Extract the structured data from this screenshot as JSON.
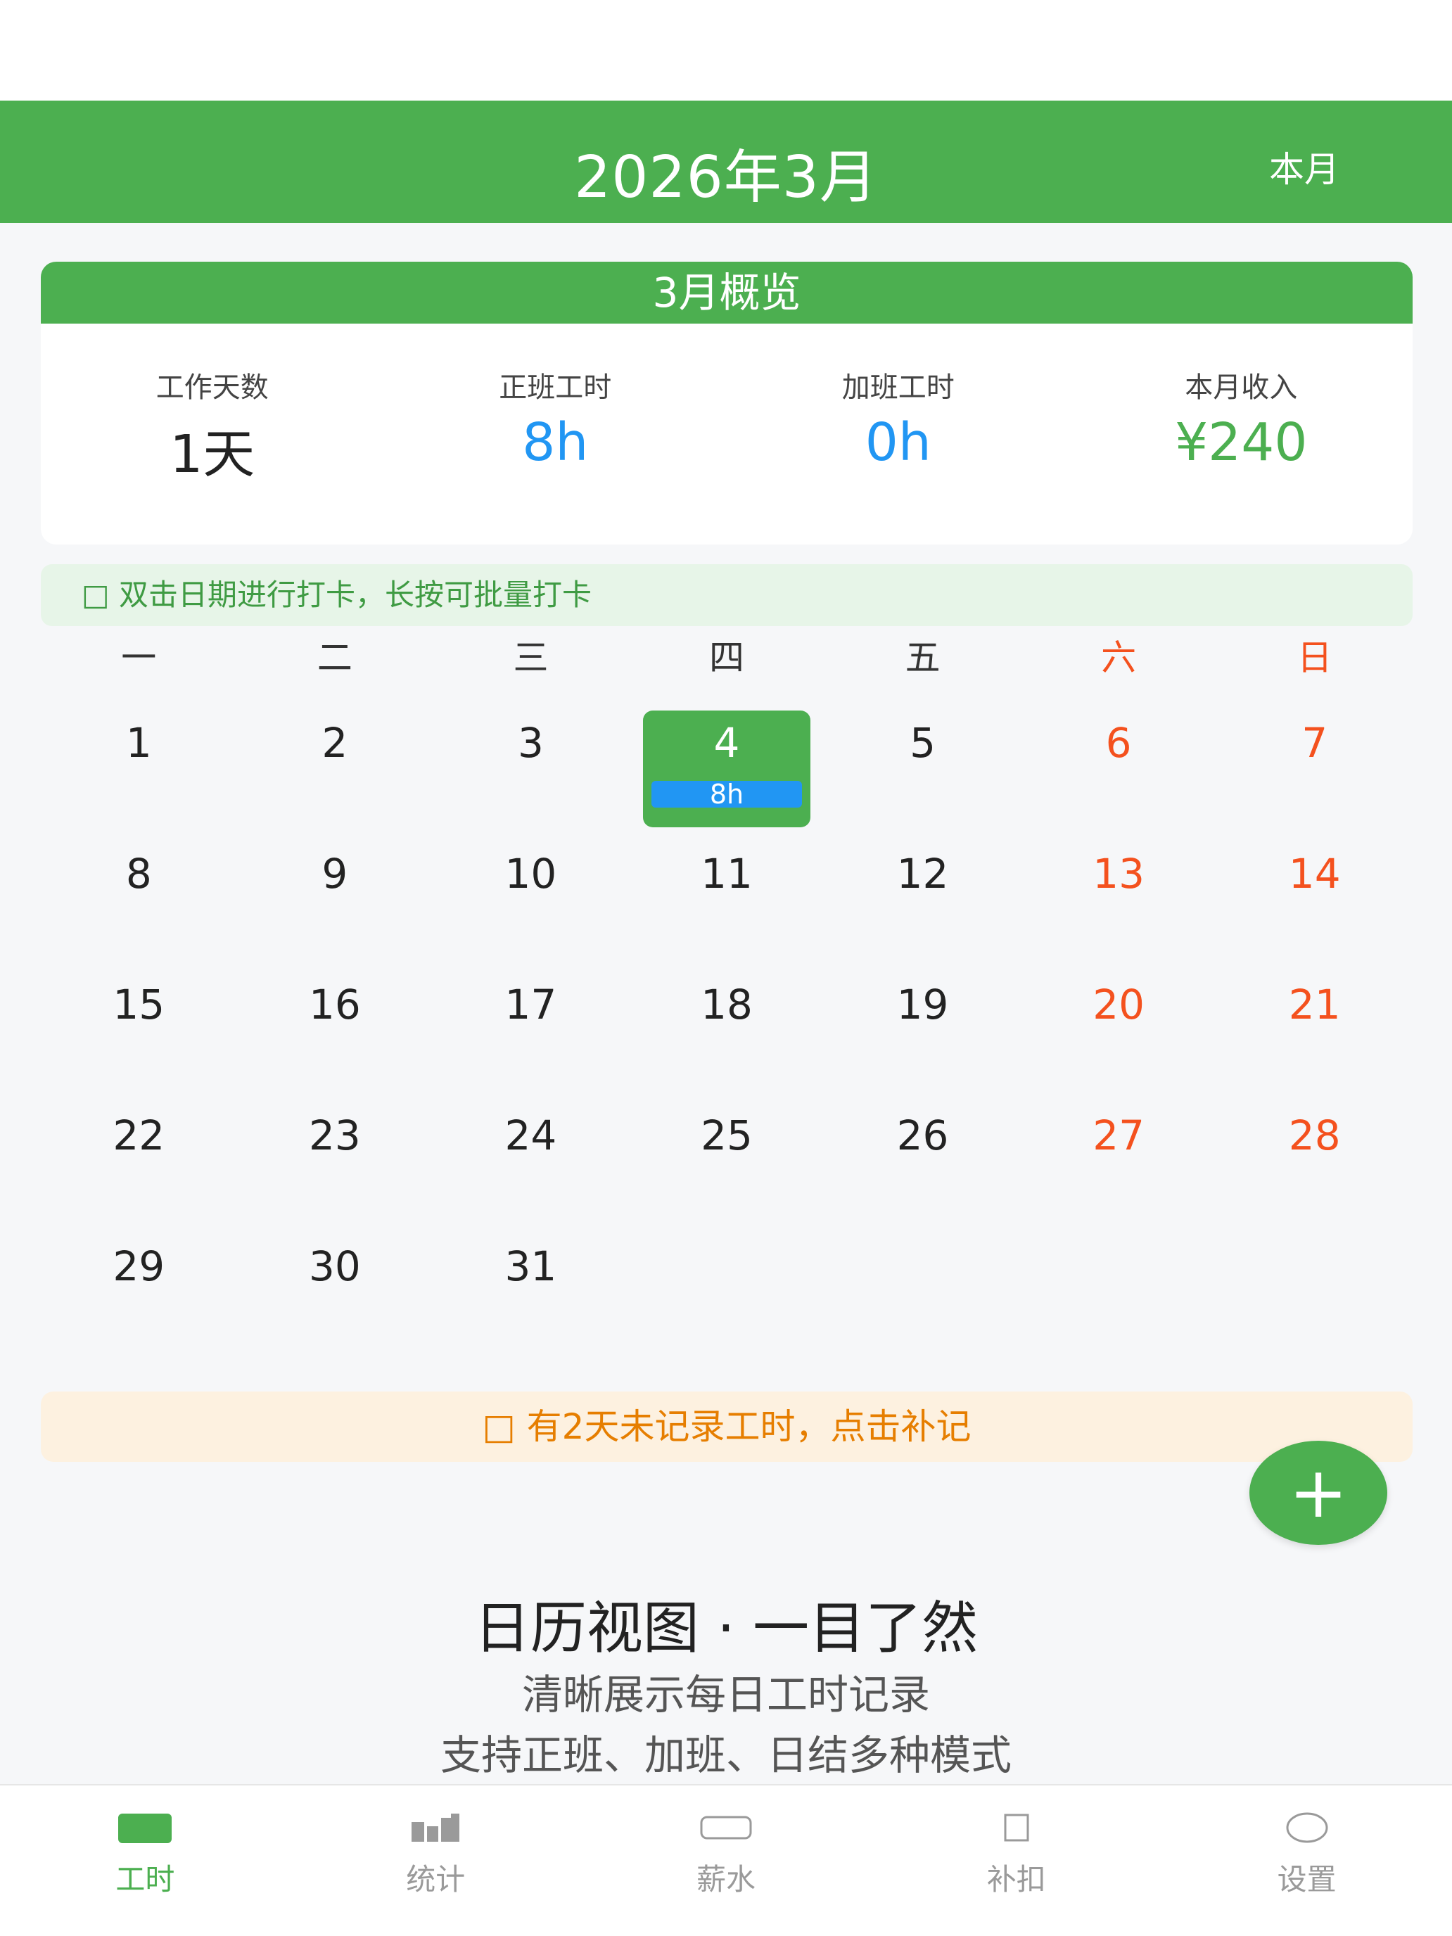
{
  "header": {
    "title": "2026年3月",
    "current_month_button": "本月"
  },
  "overview": {
    "title": "3月概览",
    "stats": [
      {
        "label": "工作天数",
        "value": "1天",
        "color": "#222222"
      },
      {
        "label": "正班工时",
        "value": "8h",
        "color": "#2196f3"
      },
      {
        "label": "加班工时",
        "value": "0h",
        "color": "#2196f3"
      },
      {
        "label": "本月收入",
        "value": "¥240",
        "color": "#4caf50"
      }
    ]
  },
  "tip_checkin": "□ 双击日期进行打卡，长按可批量打卡",
  "weekdays": [
    "一",
    "二",
    "三",
    "四",
    "五",
    "六",
    "日"
  ],
  "calendar": {
    "days": [
      {
        "n": "1"
      },
      {
        "n": "2"
      },
      {
        "n": "3"
      },
      {
        "n": "4",
        "hours": "8h"
      },
      {
        "n": "5"
      },
      {
        "n": "6"
      },
      {
        "n": "7"
      },
      {
        "n": "8"
      },
      {
        "n": "9"
      },
      {
        "n": "10"
      },
      {
        "n": "11"
      },
      {
        "n": "12"
      },
      {
        "n": "13"
      },
      {
        "n": "14"
      },
      {
        "n": "15"
      },
      {
        "n": "16"
      },
      {
        "n": "17"
      },
      {
        "n": "18"
      },
      {
        "n": "19"
      },
      {
        "n": "20"
      },
      {
        "n": "21"
      },
      {
        "n": "22"
      },
      {
        "n": "23"
      },
      {
        "n": "24"
      },
      {
        "n": "25"
      },
      {
        "n": "26"
      },
      {
        "n": "27"
      },
      {
        "n": "28"
      },
      {
        "n": "29"
      },
      {
        "n": "30"
      },
      {
        "n": "31"
      }
    ]
  },
  "tip_missing": "□ 有2天未记录工时，点击补记",
  "fab_label": "+",
  "promo": {
    "title": "日历视图 · 一目了然",
    "line1": "清晰展示每日工时记录",
    "line2": "支持正班、加班、日结多种模式"
  },
  "tabbar": [
    {
      "label": "工时",
      "icon": "work-hours-icon",
      "active": true
    },
    {
      "label": "统计",
      "icon": "stats-icon",
      "active": false
    },
    {
      "label": "薪水",
      "icon": "salary-icon",
      "active": false
    },
    {
      "label": "补扣",
      "icon": "adjust-icon",
      "active": false
    },
    {
      "label": "设置",
      "icon": "settings-icon",
      "active": false
    }
  ],
  "colors": {
    "primary": "#4caf50",
    "weekend": "#f4511e",
    "hours_badge": "#2196f3",
    "warning": "#e67e00"
  }
}
